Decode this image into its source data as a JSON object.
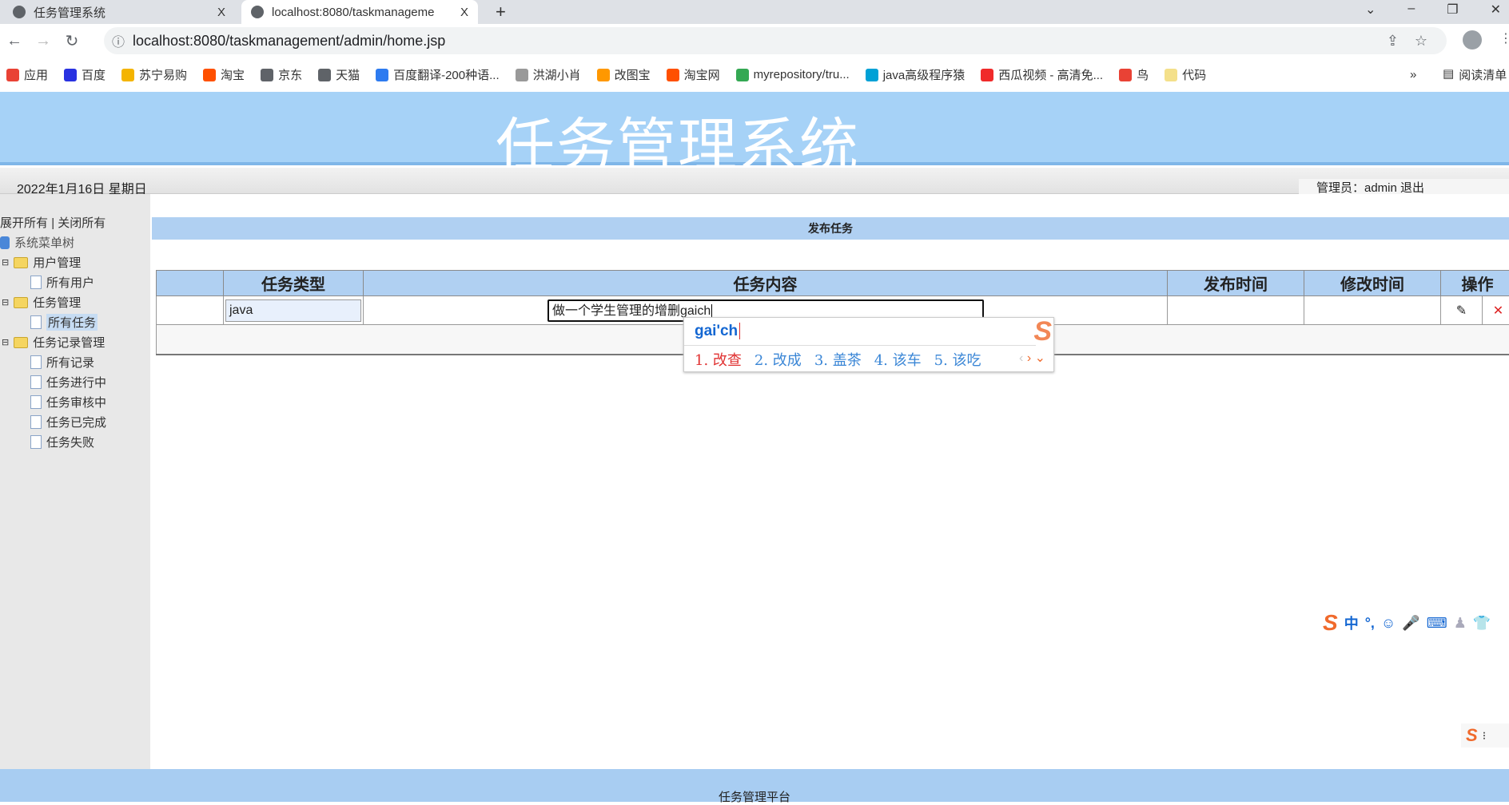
{
  "browser": {
    "tabs": [
      {
        "title": "任务管理系统"
      },
      {
        "title": "localhost:8080/taskmanageme"
      }
    ],
    "close": "X",
    "new_tab": "+",
    "url": "localhost:8080/taskmanagement/admin/home.jsp",
    "bookmarks": [
      {
        "label": "应用",
        "color": "#e94235"
      },
      {
        "label": "百度",
        "color": "#2932e1"
      },
      {
        "label": "苏宁易购",
        "color": "#f4b400"
      },
      {
        "label": "淘宝",
        "color": "#ff5000"
      },
      {
        "label": "京东",
        "color": "#5f6368"
      },
      {
        "label": "天猫",
        "color": "#5f6368"
      },
      {
        "label": "百度翻译-200种语...",
        "color": "#2d7bf0"
      },
      {
        "label": "洪湖小肖",
        "color": "#999999"
      },
      {
        "label": "改图宝",
        "color": "#ff9800"
      },
      {
        "label": "淘宝网",
        "color": "#ff5000"
      },
      {
        "label": "myrepository/tru...",
        "color": "#34a853"
      },
      {
        "label": "java高级程序猿",
        "color": "#00a1d6"
      },
      {
        "label": "西瓜视频 - 高清免...",
        "color": "#f02a2a"
      },
      {
        "label": "鸟",
        "color": "#e94235"
      },
      {
        "label": "代码",
        "color": "#f4e08a"
      }
    ],
    "more": "»",
    "reading_list": "阅读清单"
  },
  "banner": {
    "title": "任务管理系统"
  },
  "datebar": {
    "date": "2022年1月16日 星期日",
    "admin": "管理员：admin 退出"
  },
  "sidebar": {
    "expand_all": "展开所有",
    "sep": "|",
    "collapse_all": "关闭所有",
    "root": "系统菜单树",
    "groups": [
      {
        "label": "用户管理",
        "items": [
          "所有用户"
        ]
      },
      {
        "label": "任务管理",
        "items": [
          "所有任务"
        ]
      },
      {
        "label": "任务记录管理",
        "items": [
          "所有记录",
          "任务进行中",
          "任务审核中",
          "任务已完成",
          "任务失败"
        ]
      }
    ],
    "selected": "所有任务"
  },
  "main": {
    "title": "发布任务",
    "columns": [
      "",
      "任务类型",
      "任务内容",
      "发布时间",
      "修改时间",
      "操作"
    ],
    "row": {
      "type": "java",
      "content": "做一个学生管理的增删gaich",
      "publish_time": "",
      "modify_time": ""
    }
  },
  "ime": {
    "composition": "gai'ch",
    "candidates": [
      "1. 改查",
      "2. 改成",
      "3. 盖茶",
      "4. 该车",
      "5. 该吃"
    ],
    "highlight_color": "#e03030",
    "candidate_color": "#3a86d6"
  },
  "sogou_bar": {
    "mode": "中",
    "punct": "°,"
  },
  "footer": {
    "text": "任务管理平台"
  }
}
